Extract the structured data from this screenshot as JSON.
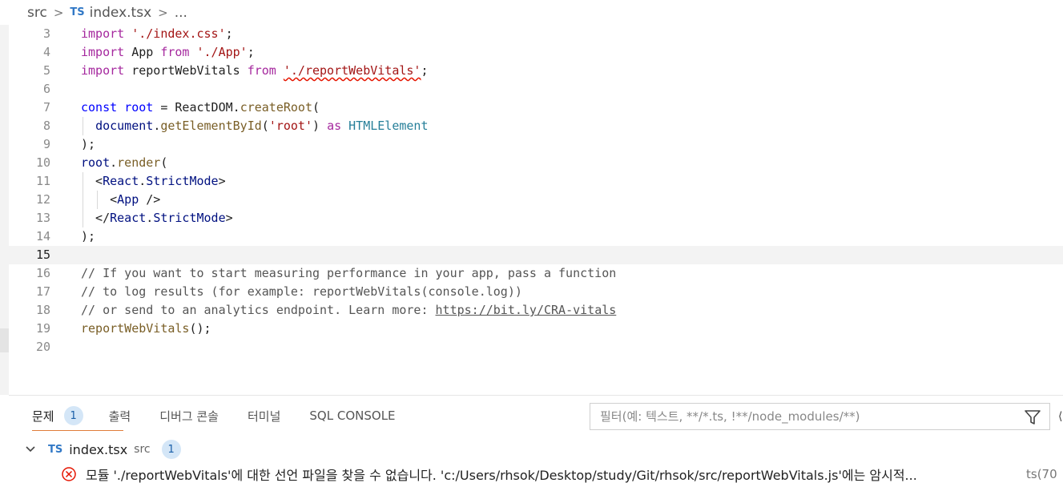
{
  "breadcrumb": {
    "folder": "src",
    "lang_badge": "TS",
    "file": "index.tsx",
    "more": "..."
  },
  "editor": {
    "current_line": 15,
    "lines": [
      {
        "n": "3",
        "tokens": [
          {
            "t": "import",
            "c": "kw"
          },
          {
            "t": " "
          },
          {
            "t": "'./index.css'",
            "c": "str"
          },
          {
            "t": ";"
          }
        ]
      },
      {
        "n": "4",
        "tokens": [
          {
            "t": "import",
            "c": "kw"
          },
          {
            "t": " App "
          },
          {
            "t": "from",
            "c": "kw"
          },
          {
            "t": " "
          },
          {
            "t": "'./App'",
            "c": "str"
          },
          {
            "t": ";"
          }
        ]
      },
      {
        "n": "5",
        "tokens": [
          {
            "t": "import",
            "c": "kw"
          },
          {
            "t": " reportWebVitals "
          },
          {
            "t": "from",
            "c": "kw"
          },
          {
            "t": " "
          },
          {
            "t": "'./reportWebVitals'",
            "c": "str sq"
          },
          {
            "t": ";"
          }
        ]
      },
      {
        "n": "6",
        "tokens": []
      },
      {
        "n": "7",
        "tokens": [
          {
            "t": "const",
            "c": "decl"
          },
          {
            "t": " "
          },
          {
            "t": "root",
            "c": "decl"
          },
          {
            "t": " = ReactDOM."
          },
          {
            "t": "createRoot",
            "c": "fn"
          },
          {
            "t": "("
          }
        ]
      },
      {
        "n": "8",
        "indent": 1,
        "tokens": [
          {
            "t": "  "
          },
          {
            "t": "document",
            "c": "var"
          },
          {
            "t": "."
          },
          {
            "t": "getElementById",
            "c": "fn"
          },
          {
            "t": "("
          },
          {
            "t": "'root'",
            "c": "str"
          },
          {
            "t": ") "
          },
          {
            "t": "as",
            "c": "kw"
          },
          {
            "t": " "
          },
          {
            "t": "HTMLElement",
            "c": "typ"
          }
        ]
      },
      {
        "n": "9",
        "tokens": [
          {
            "t": ");"
          }
        ]
      },
      {
        "n": "10",
        "tokens": [
          {
            "t": "root",
            "c": "var"
          },
          {
            "t": "."
          },
          {
            "t": "render",
            "c": "fn"
          },
          {
            "t": "("
          }
        ]
      },
      {
        "n": "11",
        "indent": 1,
        "tokens": [
          {
            "t": "  <"
          },
          {
            "t": "React",
            "c": "var"
          },
          {
            "t": "."
          },
          {
            "t": "StrictMode",
            "c": "var"
          },
          {
            "t": ">"
          }
        ]
      },
      {
        "n": "12",
        "indent": 2,
        "tokens": [
          {
            "t": "    <"
          },
          {
            "t": "App",
            "c": "var"
          },
          {
            "t": " />"
          }
        ]
      },
      {
        "n": "13",
        "indent": 1,
        "tokens": [
          {
            "t": "  </"
          },
          {
            "t": "React",
            "c": "var"
          },
          {
            "t": "."
          },
          {
            "t": "StrictMode",
            "c": "var"
          },
          {
            "t": ">"
          }
        ]
      },
      {
        "n": "14",
        "tokens": [
          {
            "t": ");"
          }
        ]
      },
      {
        "n": "15",
        "tokens": []
      },
      {
        "n": "16",
        "tokens": [
          {
            "t": "// If you want to start measuring performance in your app, pass a function",
            "c": "cmt"
          }
        ]
      },
      {
        "n": "17",
        "tokens": [
          {
            "t": "// to log results (for example: reportWebVitals(console.log))",
            "c": "cmt"
          }
        ]
      },
      {
        "n": "18",
        "tokens": [
          {
            "t": "// or send to an analytics endpoint. Learn more: ",
            "c": "cmt"
          },
          {
            "t": "https://bit.ly/CRA-vitals",
            "c": "cmt link"
          }
        ]
      },
      {
        "n": "19",
        "tokens": [
          {
            "t": "reportWebVitals",
            "c": "fn"
          },
          {
            "t": "();"
          }
        ]
      },
      {
        "n": "20",
        "tokens": []
      }
    ]
  },
  "panel": {
    "tabs": [
      {
        "label": "문제",
        "count": "1",
        "active": true
      },
      {
        "label": "출력"
      },
      {
        "label": "디버그 콘솔"
      },
      {
        "label": "터미널"
      },
      {
        "label": "SQL CONSOLE"
      }
    ],
    "filter_placeholder": "필터(예: 텍스트, **/*.ts, !**/node_modules/**)",
    "problem_file": {
      "lang_badge": "TS",
      "name": "index.tsx",
      "dir": "src",
      "count": "1"
    },
    "problem": {
      "message": "모듈 './reportWebVitals'에 대한 선언 파일을 찾을 수 없습니다. 'c:/Users/rhsok/Desktop/study/Git/rhsok/src/reportWebVitals.js'에는 암시적...",
      "code": "ts(70",
      "severity_color": "#e51400"
    }
  }
}
